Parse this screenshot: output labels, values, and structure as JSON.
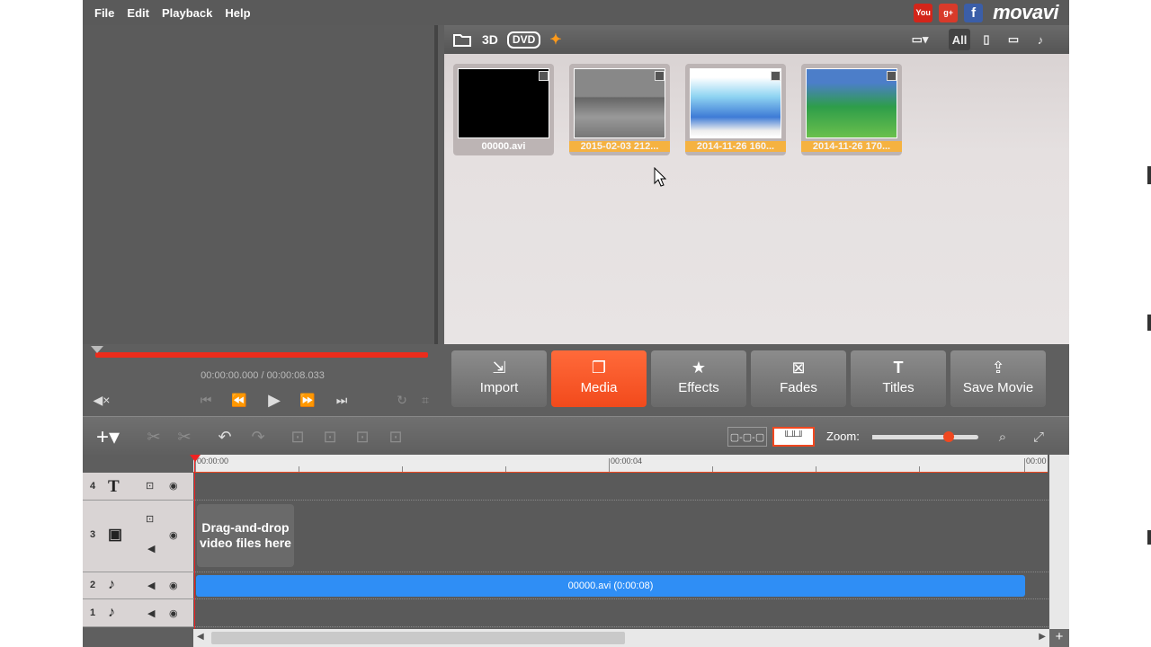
{
  "menu": [
    "File",
    "Edit",
    "Playback",
    "Help"
  ],
  "social": {
    "youtube": "You",
    "gplus": "g+",
    "facebook": "f"
  },
  "brand": "movavi",
  "library": {
    "toolbar": {
      "folder_icon": "folder-open-icon",
      "btn_3d": "3D",
      "btn_dvd": "DVD",
      "filter_all": "All"
    },
    "items": [
      {
        "caption": "00000.avi",
        "selected": false
      },
      {
        "caption": "2015-02-03 212...",
        "selected": true
      },
      {
        "caption": "2014-11-26 160...",
        "selected": true
      },
      {
        "caption": "2014-11-26 170...",
        "selected": true
      }
    ]
  },
  "player": {
    "timecode_current": "00:00:00.000",
    "timecode_sep": " / ",
    "timecode_total": "00:00:08.033"
  },
  "tabs": [
    {
      "label": "Import",
      "icon": "import-icon"
    },
    {
      "label": "Media",
      "icon": "media-icon"
    },
    {
      "label": "Effects",
      "icon": "star-icon"
    },
    {
      "label": "Fades",
      "icon": "fades-icon"
    },
    {
      "label": "Titles",
      "icon": "titles-icon"
    },
    {
      "label": "Save Movie",
      "icon": "export-icon"
    }
  ],
  "timeline": {
    "zoom_label": "Zoom:",
    "zoom_level": 0.7,
    "ruler": [
      "00:00:00",
      "00:00:04",
      "00:00"
    ],
    "tracks": [
      "4",
      "3",
      "2",
      "1"
    ],
    "dropzone": "Drag-and-drop video files here",
    "clip_label": "00000.avi (0:00:08)"
  },
  "colors": {
    "accent": "#f24a1c",
    "clip": "#2f8ef5",
    "progress": "#ec2c1c"
  }
}
